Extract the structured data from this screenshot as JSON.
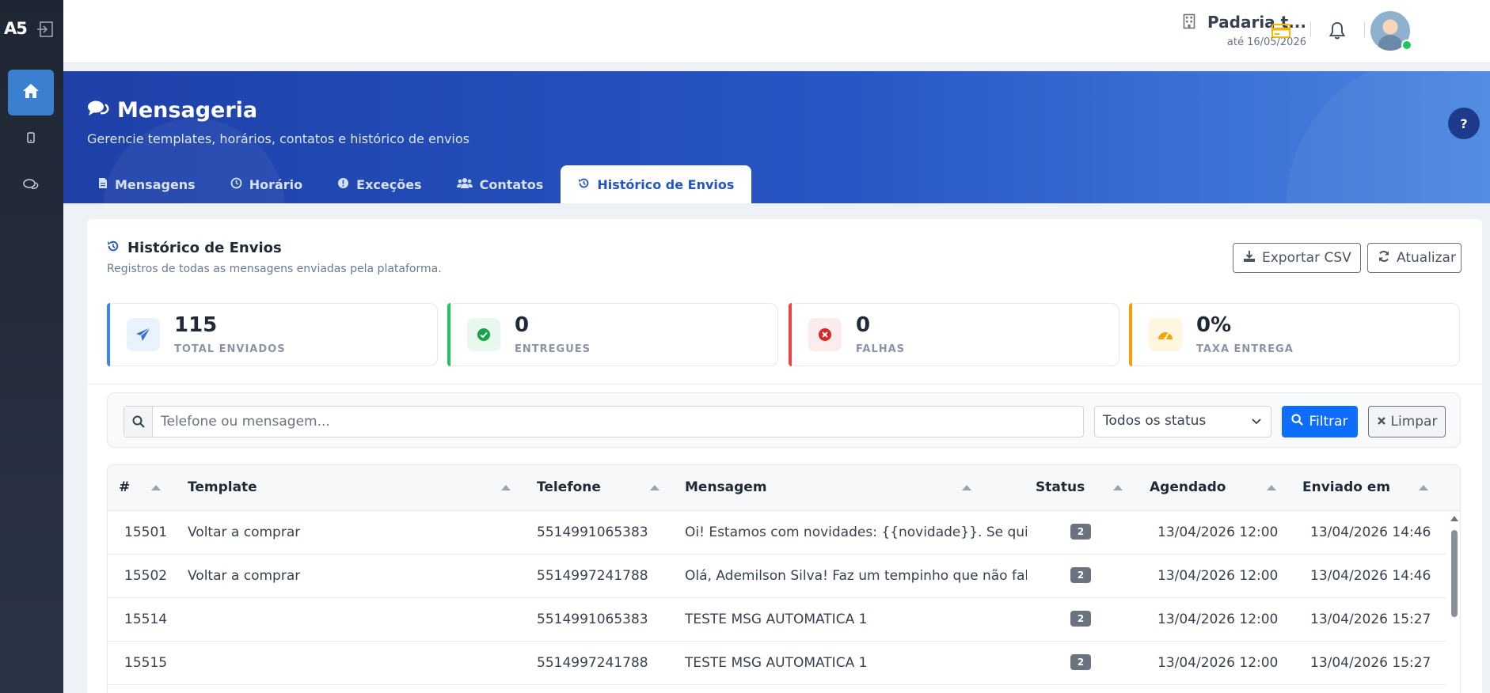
{
  "sidebar": {
    "logo": "A5",
    "items": [
      {
        "name": "home",
        "icon": "home-icon"
      },
      {
        "name": "mobile",
        "icon": "mobile-icon"
      },
      {
        "name": "messages",
        "icon": "chat-icon"
      }
    ]
  },
  "topbar": {
    "company_name": "Padaria t...",
    "company_valid": "até 16/05/2026",
    "icons": [
      "credit-card-icon",
      "bell-icon",
      "theme-toggle-icon"
    ],
    "accent": "#f2b705"
  },
  "hero": {
    "title": "Mensageria",
    "subtitle": "Gerencie templates, horários, contatos e histórico de envios",
    "help_label": "?",
    "tabs": [
      {
        "label": "Mensagens",
        "icon": "file-icon",
        "active": false
      },
      {
        "label": "Horário",
        "icon": "clock-icon",
        "active": false
      },
      {
        "label": "Exceções",
        "icon": "alert-icon",
        "active": false
      },
      {
        "label": "Contatos",
        "icon": "users-icon",
        "active": false
      },
      {
        "label": "Histórico de Envios",
        "icon": "history-icon",
        "active": true
      }
    ]
  },
  "panel": {
    "title": "Histórico de Envios",
    "subtitle": "Registros de todas as mensagens enviadas pela plataforma.",
    "export_label": "Exportar CSV",
    "refresh_label": "Atualizar"
  },
  "stats": [
    {
      "value": "115",
      "label": "TOTAL ENVIADOS",
      "color": "#3b82f6",
      "icon": "send-icon"
    },
    {
      "value": "0",
      "label": "ENTREGUES",
      "color": "#22c55e",
      "icon": "check-circle-icon"
    },
    {
      "value": "0",
      "label": "FALHAS",
      "color": "#ef4444",
      "icon": "x-circle-icon"
    },
    {
      "value": "0%",
      "label": "TAXA ENTREGA",
      "color": "#f59e0b",
      "icon": "gauge-icon"
    }
  ],
  "filters": {
    "search_placeholder": "Telefone ou mensagem...",
    "status_selected": "Todos os status",
    "filter_label": "Filtrar",
    "clear_label": "Limpar"
  },
  "table": {
    "columns": [
      "#",
      "Template",
      "Telefone",
      "Mensagem",
      "Status",
      "Agendado",
      "Enviado em"
    ],
    "rows": [
      {
        "id": "15501",
        "template": "Voltar a comprar",
        "phone": "5514991065383",
        "message": "Oi! Estamos com novidades: {{novidade}}. Se quiser saber mais",
        "status": "2",
        "scheduled": "13/04/2026 12:00",
        "sent": "13/04/2026 14:46"
      },
      {
        "id": "15502",
        "template": "Voltar a comprar",
        "phone": "5514997241788",
        "message": "Olá, Ademilson Silva! Faz um tempinho que não falamos",
        "status": "2",
        "scheduled": "13/04/2026 12:00",
        "sent": "13/04/2026 14:46"
      },
      {
        "id": "15514",
        "template": "",
        "phone": "5514991065383",
        "message": "TESTE MSG AUTOMATICA 1",
        "status": "2",
        "scheduled": "13/04/2026 12:00",
        "sent": "13/04/2026 15:27"
      },
      {
        "id": "15515",
        "template": "",
        "phone": "5514997241788",
        "message": "TESTE MSG AUTOMATICA 1",
        "status": "2",
        "scheduled": "13/04/2026 12:00",
        "sent": "13/04/2026 15:27"
      }
    ]
  }
}
